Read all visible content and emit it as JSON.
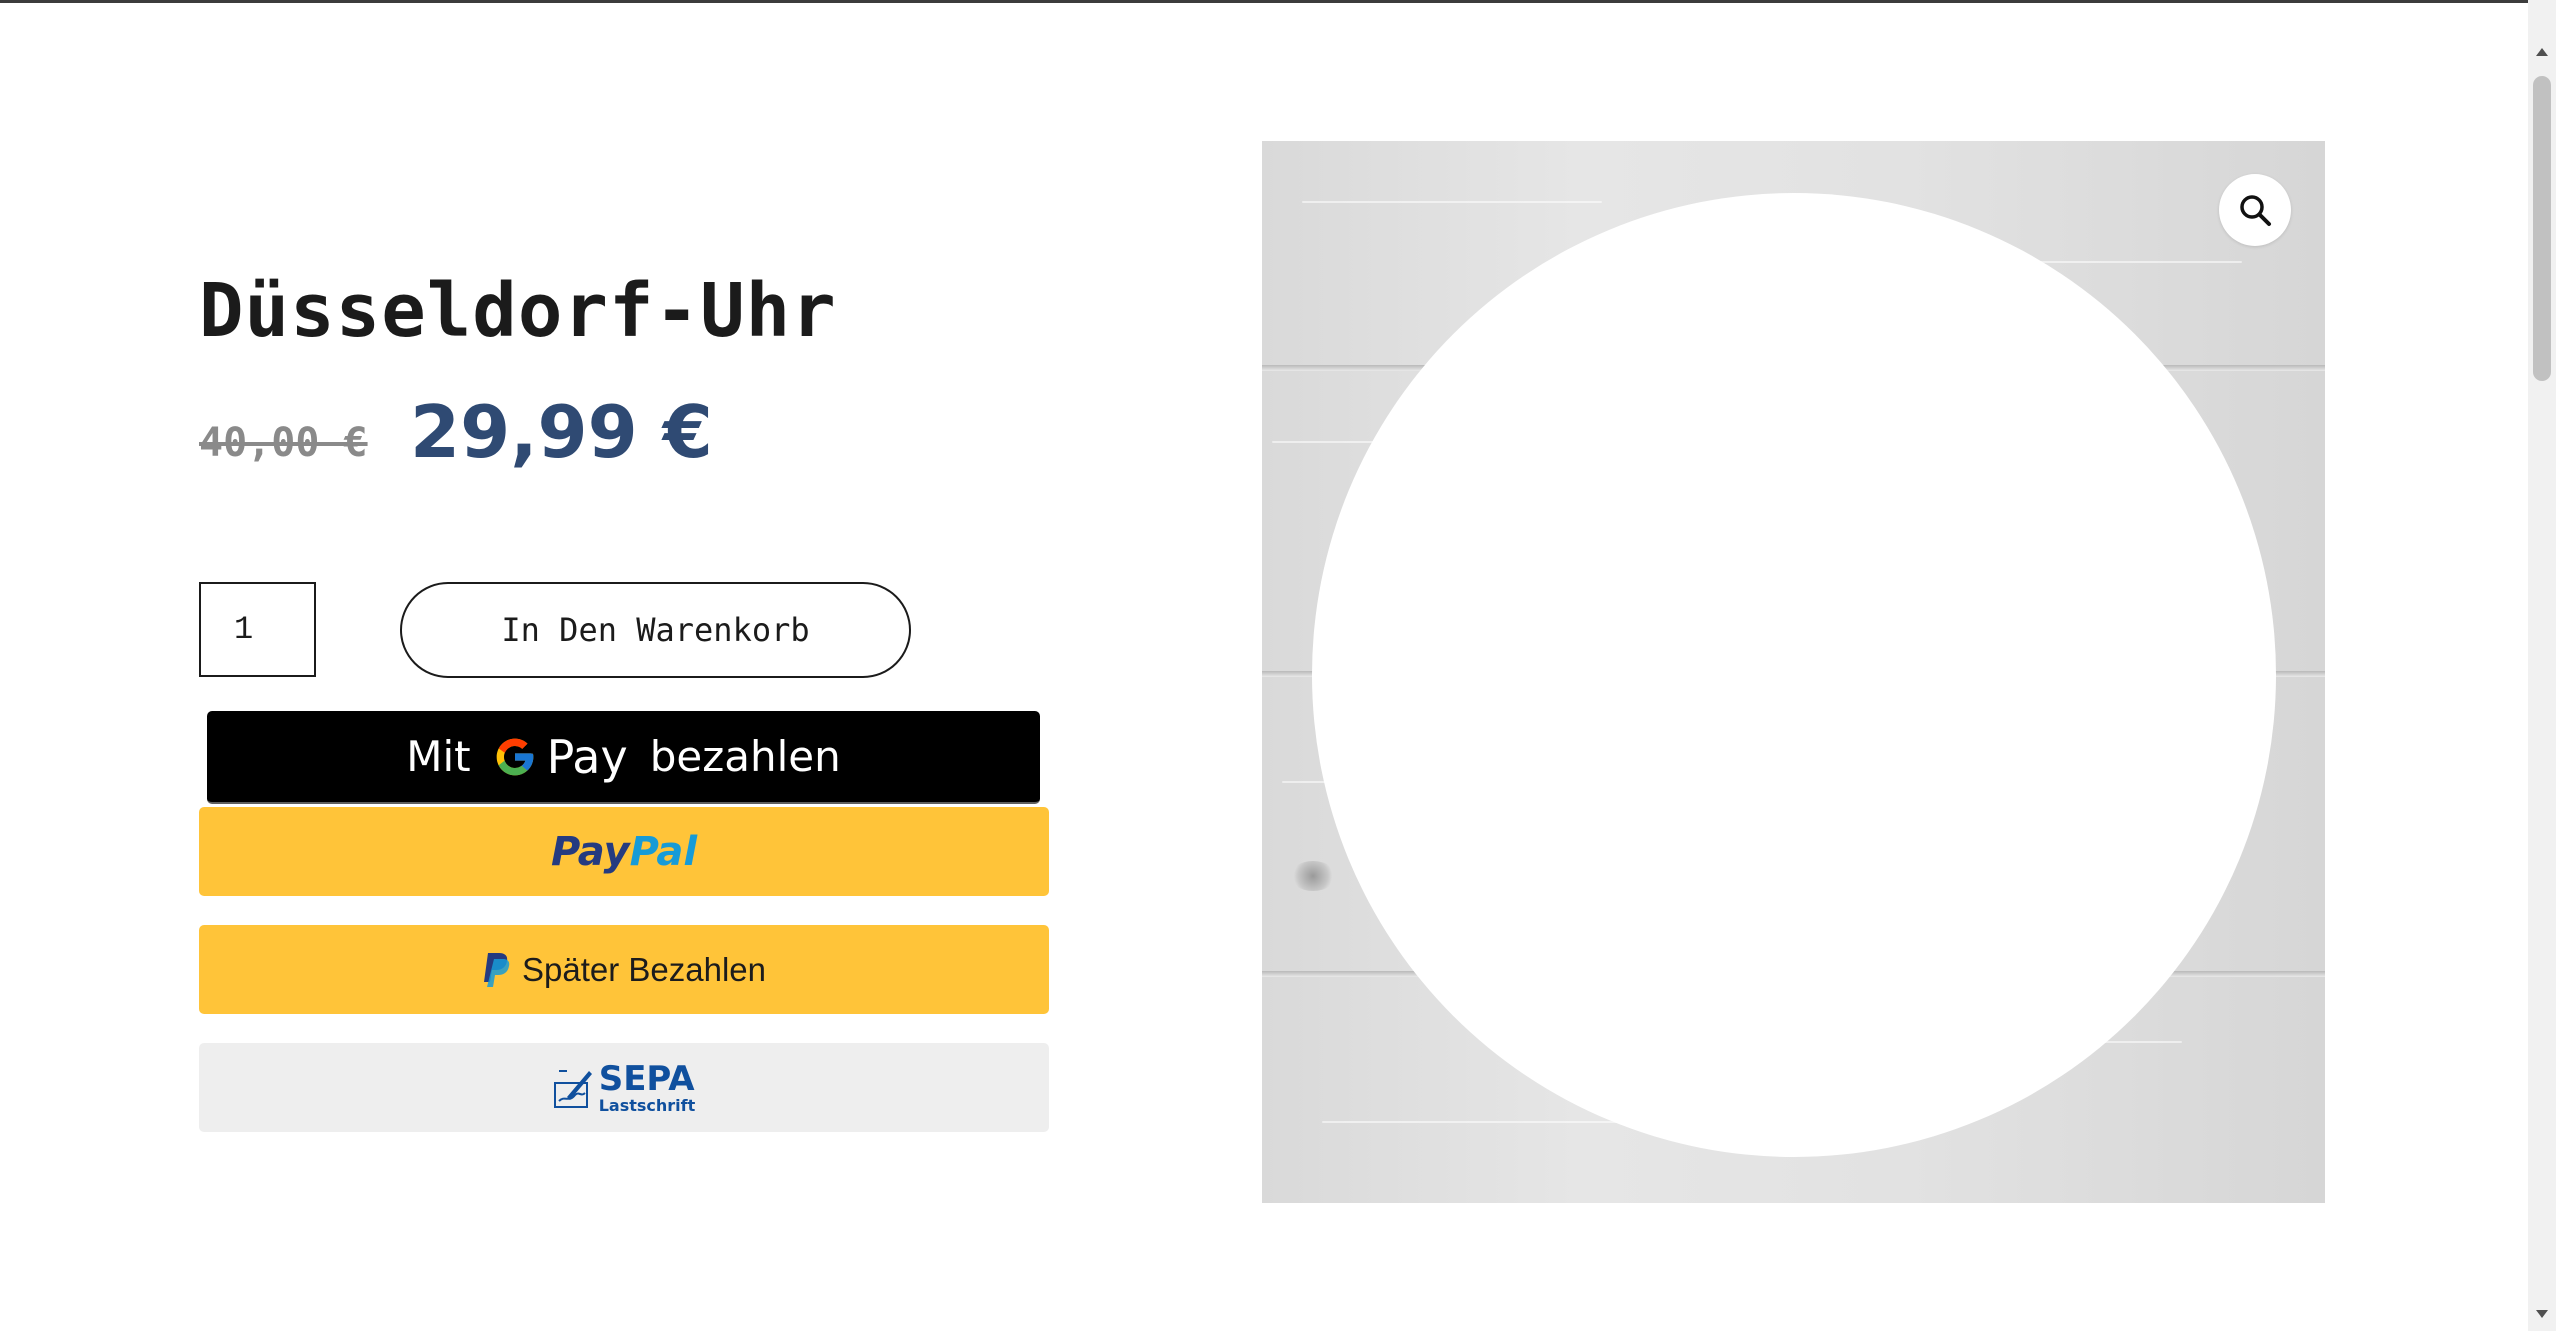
{
  "product": {
    "title": "Düsseldorf-Uhr",
    "old_price": "40,00 €",
    "new_price": "29,99 €",
    "quantity": "1",
    "add_to_cart_label": "In Den Warenkorb"
  },
  "payments": {
    "gpay_prefix": "Mit",
    "gpay_pay": "Pay",
    "gpay_suffix": "bezahlen",
    "paypal_pay": "Pay",
    "paypal_pal": "Pal",
    "later_label": "Später Bezahlen",
    "sepa_title": "SEPA",
    "sepa_subtitle": "Lastschrift"
  },
  "icons": {
    "zoom": "magnifier-icon",
    "google": "google-g-icon",
    "paypal": "paypal-p-icon",
    "sepa": "sepa-signature-icon"
  },
  "colors": {
    "price_accent": "#2f4a73",
    "paypal_yellow": "#ffc439",
    "sepa_blue": "#10509e"
  }
}
